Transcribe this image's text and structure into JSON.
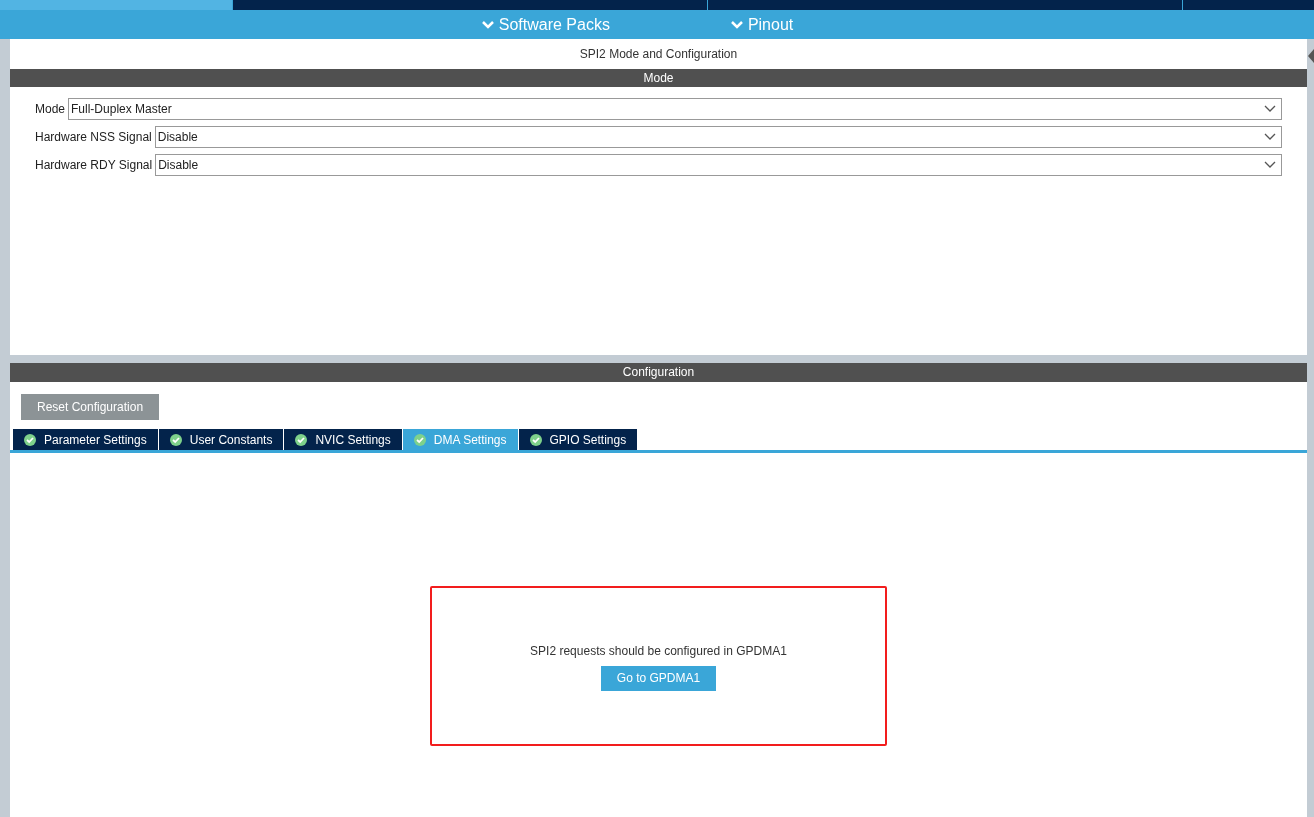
{
  "top_tabs": [
    {
      "selected": true
    },
    {
      "selected": false
    },
    {
      "selected": false
    },
    {
      "selected": false
    }
  ],
  "menu": [
    "Software Packs",
    "Pinout"
  ],
  "panel_title": "SPI2 Mode and Configuration",
  "mode": {
    "header": "Mode",
    "fields": [
      {
        "label": "Mode",
        "value": "Full-Duplex Master"
      },
      {
        "label": "Hardware NSS Signal",
        "value": "Disable"
      },
      {
        "label": "Hardware RDY Signal",
        "value": "Disable"
      }
    ]
  },
  "configuration": {
    "header": "Configuration",
    "reset_button": "Reset Configuration",
    "tabs": [
      {
        "label": "Parameter Settings",
        "selected": false
      },
      {
        "label": "User Constants",
        "selected": false
      },
      {
        "label": "NVIC Settings",
        "selected": false
      },
      {
        "label": "DMA Settings",
        "selected": true
      },
      {
        "label": "GPIO Settings",
        "selected": false
      }
    ],
    "message": "SPI2 requests should be configured in GPDMA1",
    "button": "Go to GPDMA1"
  }
}
